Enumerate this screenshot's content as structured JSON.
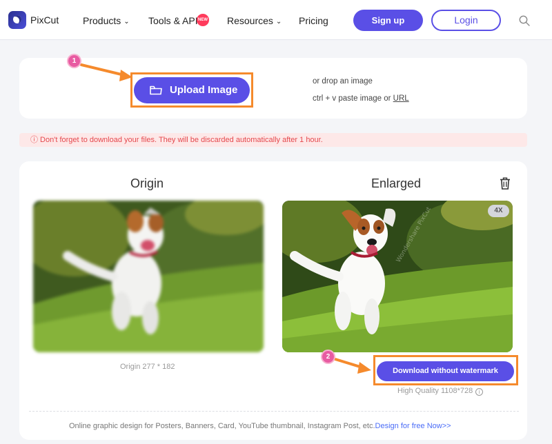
{
  "header": {
    "brand": "PixCut",
    "nav": {
      "products": "Products",
      "tools_api": "Tools & API",
      "new_badge": "NEW",
      "resources": "Resources",
      "pricing": "Pricing"
    },
    "signup": "Sign up",
    "login": "Login"
  },
  "upload": {
    "button": "Upload Image",
    "drop_text": "or drop an image",
    "paste_prefix": "ctrl + v paste image or ",
    "url_link": "URL"
  },
  "warning": "ⓘ Don't forget to download your files. They will be discarded automatically after 1 hour.",
  "result": {
    "origin_title": "Origin",
    "enlarged_title": "Enlarged",
    "scale_badge": "4X",
    "origin_size": "Origin 277 * 182",
    "download_button": "Download without watermark",
    "quality_text": "High Quality 1108*728",
    "watermark": "Wondershare PixCut"
  },
  "footer": {
    "text": "Online graphic design for Posters, Banners, Card, YouTube thumbnail, Instagram Post, etc.",
    "link": "Design for free Now>>"
  },
  "annotations": {
    "step1": "1",
    "step2": "2",
    "accent": "#f58a2c"
  },
  "colors": {
    "primary": "#5a4fe6",
    "warning": "#e5484d"
  }
}
